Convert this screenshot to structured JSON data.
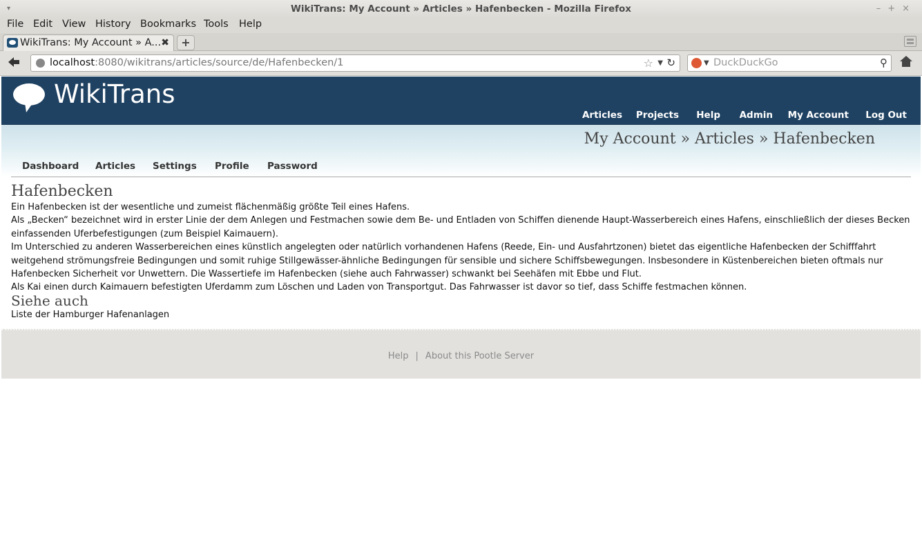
{
  "window": {
    "title": "WikiTrans: My Account » Articles » Hafenbecken - Mozilla Firefox",
    "menu_glyph": "▾",
    "controls": [
      "–",
      "+",
      "×"
    ]
  },
  "menubar": {
    "items": [
      {
        "label": "File"
      },
      {
        "label": "Edit"
      },
      {
        "label": "View"
      },
      {
        "label": "History"
      },
      {
        "label": "Bookmarks"
      },
      {
        "label": "Tools"
      },
      {
        "label": "Help"
      }
    ]
  },
  "tabs": [
    {
      "title": "WikiTrans: My Account » A...",
      "icon": "speech-bubble-icon",
      "close": "✖"
    }
  ],
  "new_tab_glyph": "+",
  "urlbar": {
    "host": "localhost",
    "rest": ":8080/wikitrans/articles/source/de/Hafenbecken/1"
  },
  "searchbar": {
    "placeholder": "DuckDuckGo"
  },
  "site": {
    "brand": "WikiTrans",
    "topnav": [
      "Articles",
      "Projects",
      "Help",
      "Admin",
      "My Account",
      "Log Out"
    ],
    "breadcrumb": "My Account » Articles » Hafenbecken",
    "subnav": [
      "Dashboard",
      "Articles",
      "Settings",
      "Profile",
      "Password"
    ]
  },
  "article": {
    "title": "Hafenbecken",
    "paragraphs": [
      "Ein Hafenbecken ist der wesentliche und zumeist flächenmäßig größte Teil eines Hafens.",
      "Als „Becken“ bezeichnet wird in erster Linie der dem Anlegen und Festmachen sowie dem Be- und Entladen von Schiffen dienende Haupt-Wasserbereich eines Hafens, einschließlich der dieses Becken einfassenden Uferbefestigungen (zum Beispiel Kaimauern).",
      "Im Unterschied zu anderen Wasserbereichen eines künstlich angelegten oder natürlich vorhandenen Hafens (Reede, Ein- und Ausfahrtzonen) bietet das eigentliche Hafenbecken der Schifffahrt weitgehend strömungsfreie Bedingungen und somit ruhige Stillgewässer-ähnliche Bedingungen für sensible und sichere Schiffsbewegungen. Insbesondere in Küstenbereichen bieten oftmals nur Hafenbecken Sicherheit vor Unwettern. Die Wassertiefe im Hafenbecken (siehe auch Fahrwasser) schwankt bei Seehäfen mit Ebbe und Flut.",
      "Als Kai einen durch Kaimauern befestigten Uferdamm zum Löschen und Laden von Transportgut. Das Fahrwasser ist davor so tief, dass Schiffe festmachen können."
    ],
    "see_also_heading": "Siehe auch",
    "see_also_text": "Liste der Hamburger Hafenanlagen"
  },
  "footer": {
    "links": [
      "Help",
      "About this Pootle Server"
    ],
    "separator": "|"
  },
  "colors": {
    "header_bg": "#1f4262",
    "footer_bg": "#e2e1de",
    "link_text": "#8a8a8a"
  }
}
